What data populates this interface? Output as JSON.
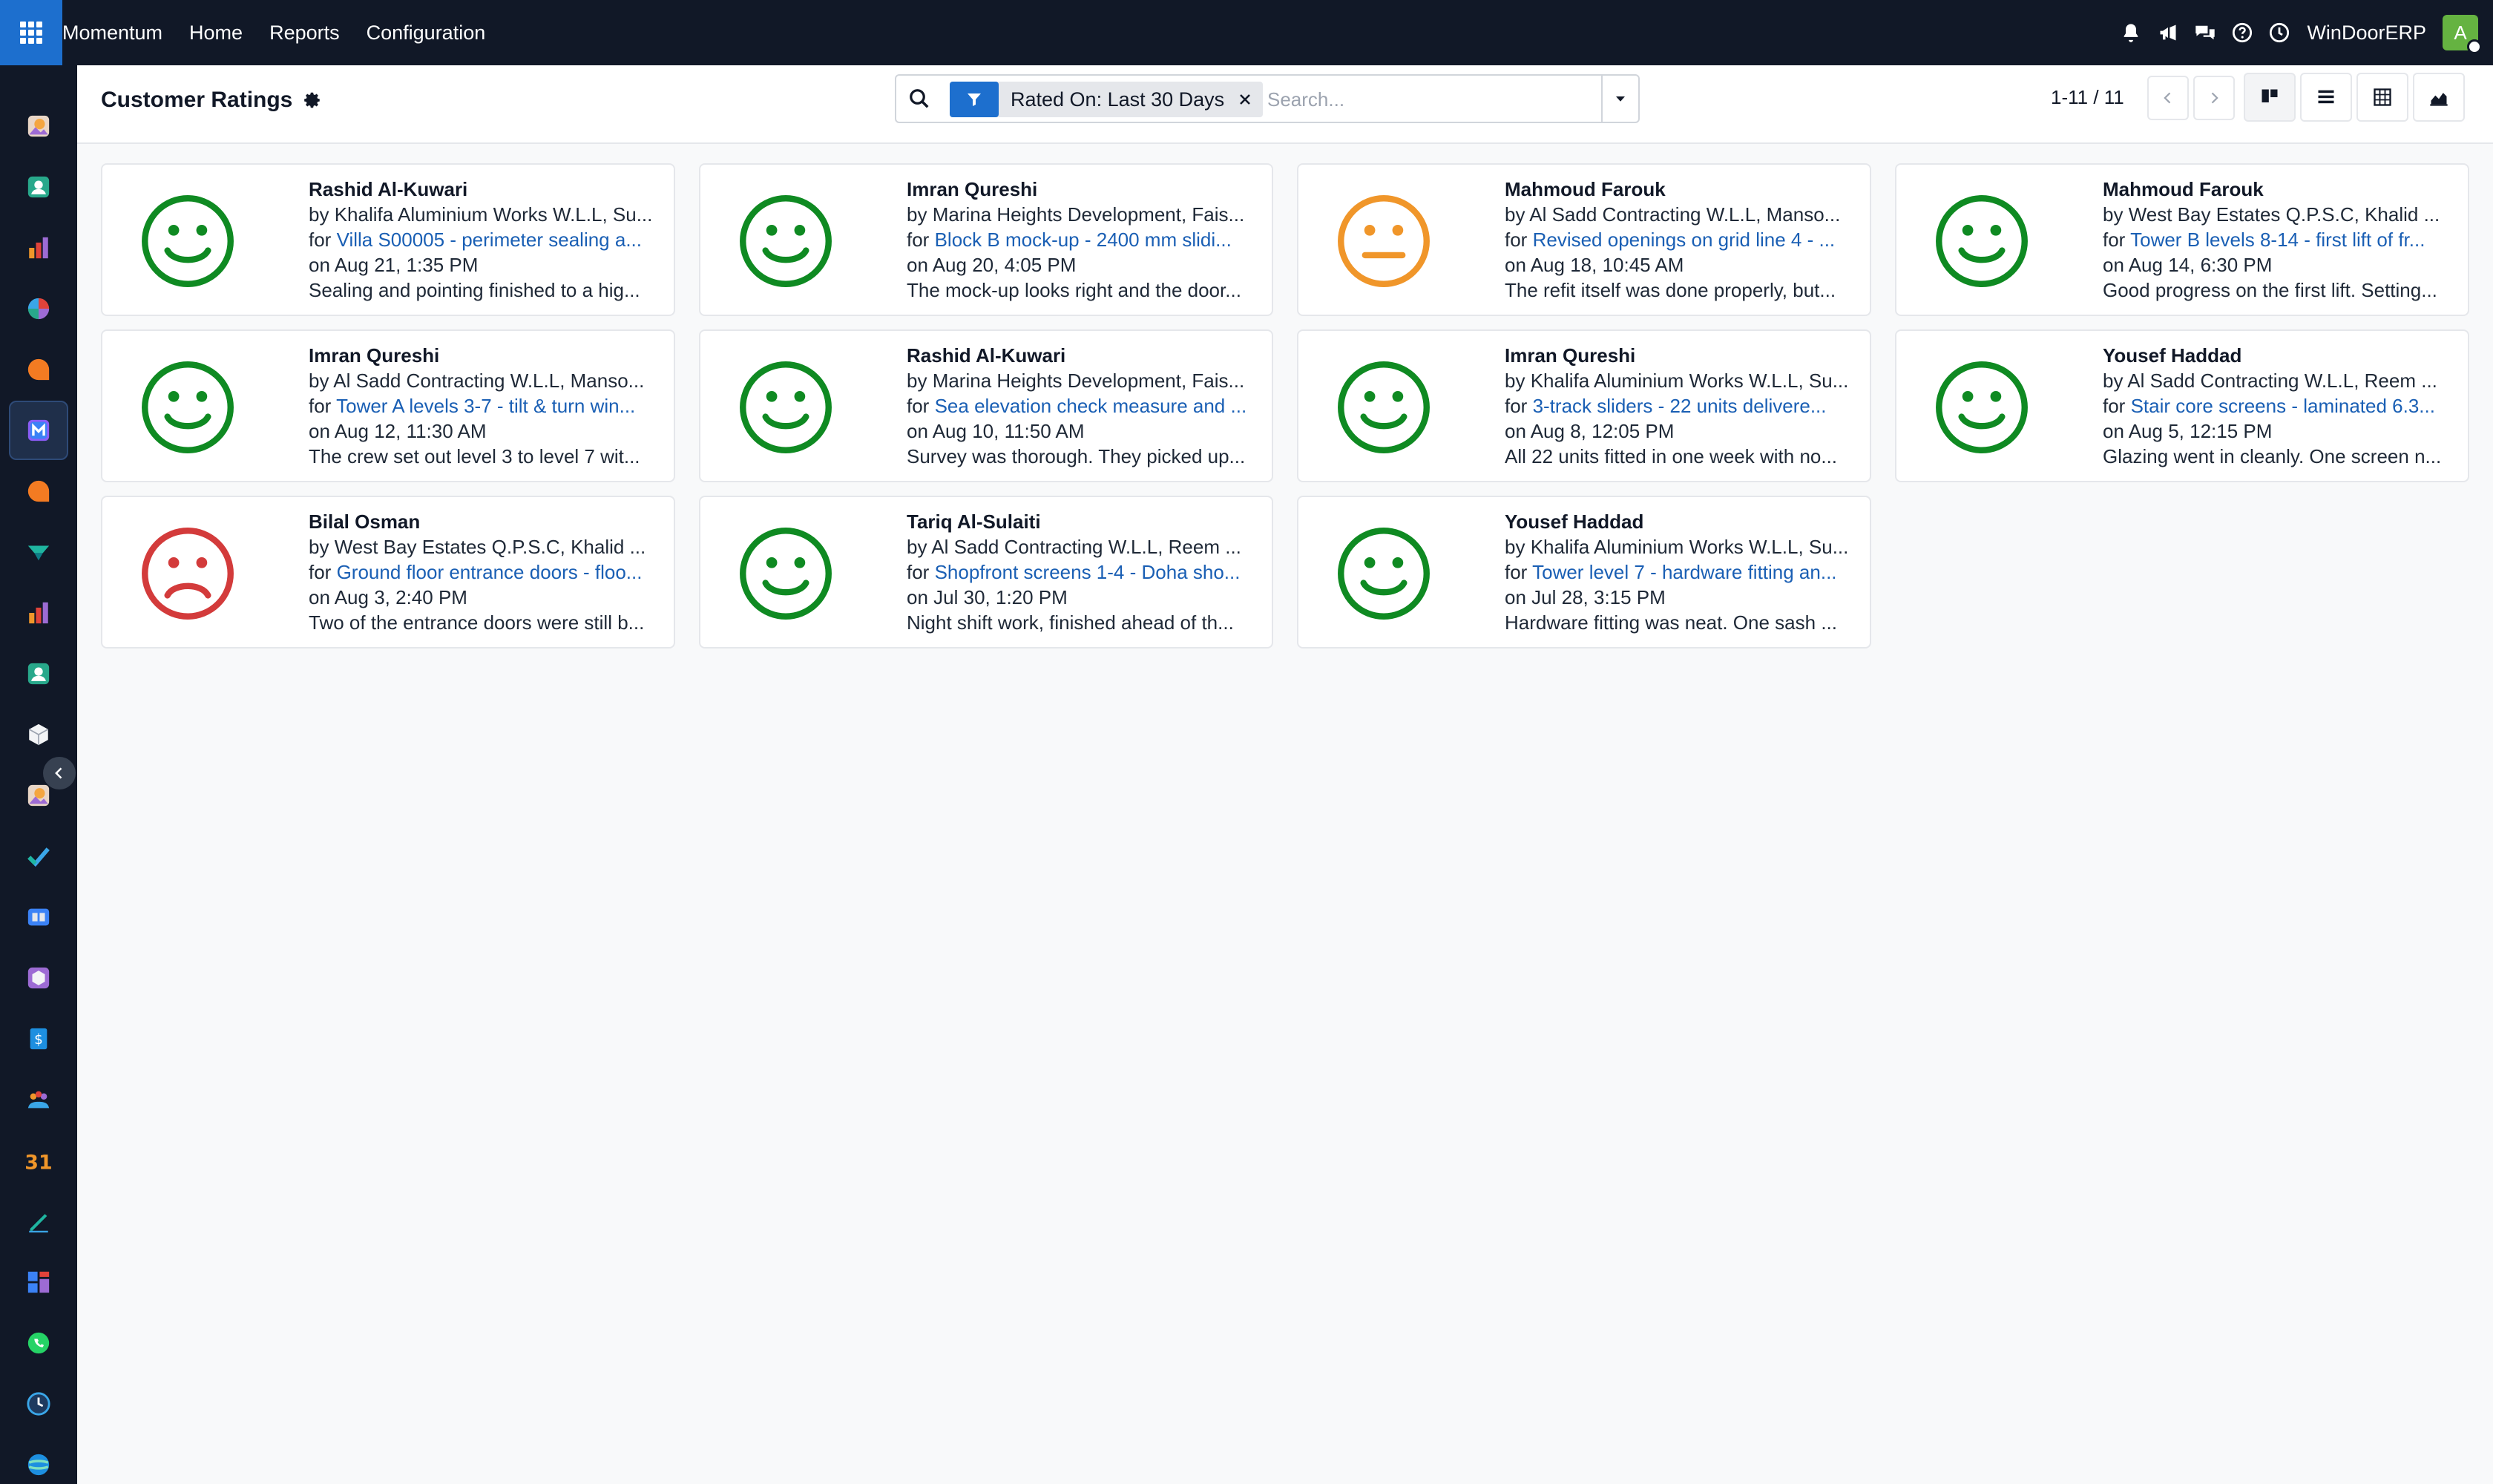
{
  "navbar": {
    "brand": "Momentum",
    "menus": [
      "Home",
      "Reports",
      "Configuration"
    ],
    "company": "WinDoorERP",
    "avatar_letter": "A",
    "icons": [
      "bell-icon",
      "megaphone-icon",
      "chat-icon",
      "help-icon",
      "clock-icon"
    ]
  },
  "sidebar": {
    "apps": [
      "photo-app-icon",
      "contacts-app-icon",
      "dashboard-app-icon",
      "pie-chart-app-icon",
      "chat-bubble-app-icon",
      "momentum-app-icon",
      "discuss-app-icon",
      "flow-app-icon",
      "reporting-app-icon",
      "directory-app-icon",
      "box-app-icon",
      "photo-app-icon-2",
      "checkmark-app-icon",
      "knowledge-app-icon",
      "inventory-app-icon",
      "billing-app-icon",
      "people-app-icon",
      "calendar-app-icon",
      "sign-app-icon",
      "spreadsheet-app-icon",
      "whatsapp-app-icon",
      "timer-app-icon",
      "website-app-icon"
    ],
    "active_index": 5
  },
  "control_panel": {
    "title": "Customer Ratings",
    "filter_facet": "Rated On: Last 30 Days",
    "search_placeholder": "Search...",
    "pager": "1-11 / 11",
    "views": [
      "kanban-view-icon",
      "list-view-icon",
      "pivot-view-icon",
      "graph-view-icon"
    ],
    "active_view": "kanban-view-icon"
  },
  "colors": {
    "positive": "#0f8a22",
    "neutral": "#f0962a",
    "negative": "#d33b3b",
    "link": "#1a5fb4",
    "navbar": "#111827",
    "accent": "#1d6fce"
  },
  "ratings": [
    {
      "name": "Rashid Al-Kuwari",
      "by": "Khalifa Aluminium Works W.L.L, Su...",
      "for": "Villa S00005 - perimeter sealing a...",
      "on": "Aug 21, 1:35 PM",
      "comment": "Sealing and pointing finished to a hig...",
      "mood": "positive"
    },
    {
      "name": "Imran Qureshi",
      "by": "Marina Heights Development, Fais...",
      "for": "Block B mock-up - 2400 mm slidi...",
      "on": "Aug 20, 4:05 PM",
      "comment": "The mock-up looks right and the door...",
      "mood": "positive"
    },
    {
      "name": "Mahmoud Farouk",
      "by": "Al Sadd Contracting W.L.L, Manso...",
      "for": "Revised openings on grid line 4 - ...",
      "on": "Aug 18, 10:45 AM",
      "comment": "The refit itself was done properly, but...",
      "mood": "neutral"
    },
    {
      "name": "Mahmoud Farouk",
      "by": "West Bay Estates Q.P.S.C, Khalid ...",
      "for": "Tower B levels 8-14 - first lift of fr...",
      "on": "Aug 14, 6:30 PM",
      "comment": "Good progress on the first lift. Setting...",
      "mood": "positive"
    },
    {
      "name": "Imran Qureshi",
      "by": "Al Sadd Contracting W.L.L, Manso...",
      "for": "Tower A levels 3-7 - tilt & turn win...",
      "on": "Aug 12, 11:30 AM",
      "comment": "The crew set out level 3 to level 7 wit...",
      "mood": "positive"
    },
    {
      "name": "Rashid Al-Kuwari",
      "by": "Marina Heights Development, Fais...",
      "for": "Sea elevation check measure and ...",
      "on": "Aug 10, 11:50 AM",
      "comment": "Survey was thorough. They picked up...",
      "mood": "positive"
    },
    {
      "name": "Imran Qureshi",
      "by": "Khalifa Aluminium Works W.L.L, Su...",
      "for": "3-track sliders - 22 units delivere...",
      "on": "Aug 8, 12:05 PM",
      "comment": "All 22 units fitted in one week with no...",
      "mood": "positive"
    },
    {
      "name": "Yousef Haddad",
      "by": "Al Sadd Contracting W.L.L, Reem ...",
      "for": "Stair core screens - laminated 6.3...",
      "on": "Aug 5, 12:15 PM",
      "comment": "Glazing went in cleanly. One screen n...",
      "mood": "positive"
    },
    {
      "name": "Bilal Osman",
      "by": "West Bay Estates Q.P.S.C, Khalid ...",
      "for": "Ground floor entrance doors - floo...",
      "on": "Aug 3, 2:40 PM",
      "comment": "Two of the entrance doors were still b...",
      "mood": "negative"
    },
    {
      "name": "Tariq Al-Sulaiti",
      "by": "Al Sadd Contracting W.L.L, Reem ...",
      "for": "Shopfront screens 1-4 - Doha sho...",
      "on": "Jul 30, 1:20 PM",
      "comment": "Night shift work, finished ahead of th...",
      "mood": "positive"
    },
    {
      "name": "Yousef Haddad",
      "by": "Khalifa Aluminium Works W.L.L, Su...",
      "for": "Tower level 7 - hardware fitting an...",
      "on": "Jul 28, 3:15 PM",
      "comment": "Hardware fitting was neat. One sash ...",
      "mood": "positive"
    }
  ]
}
